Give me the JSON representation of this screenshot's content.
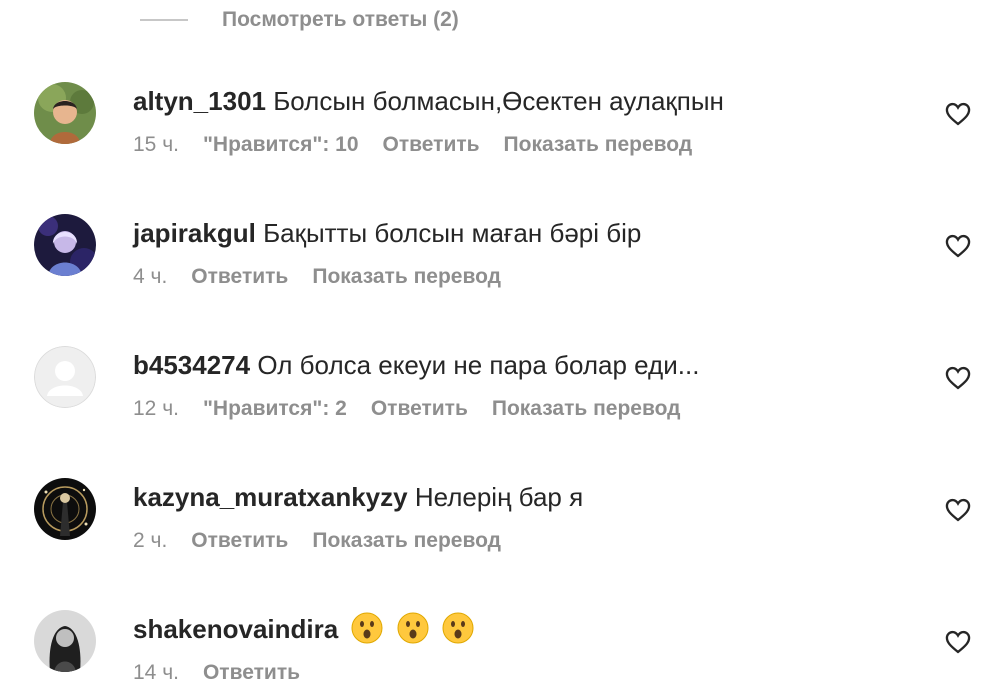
{
  "view_replies": {
    "label": "Посмотреть ответы (2)"
  },
  "comments": [
    {
      "username": "altyn_1301",
      "text": "Болсын болмасын,Өсектен аулақпын",
      "time": "15 ч.",
      "likes": "\"Нравится\": 10",
      "reply": "Ответить",
      "translate": "Показать перевод"
    },
    {
      "username": "japirakgul",
      "text": "Бақытты болсын маған бәрі бір",
      "time": "4 ч.",
      "reply": "Ответить",
      "translate": "Показать перевод"
    },
    {
      "username": "b4534274",
      "text": "Ол болса екеуи не пара болар еди...",
      "time": "12 ч.",
      "likes": "\"Нравится\": 2",
      "reply": "Ответить",
      "translate": "Показать перевод"
    },
    {
      "username": "kazyna_muratxankyzy",
      "text": "Нелерің бар я",
      "time": "2 ч.",
      "reply": "Ответить",
      "translate": "Показать перевод"
    },
    {
      "username": "shakenovaindira",
      "emojis": [
        "surprised-face-emoji",
        "surprised-face-emoji",
        "surprised-face-emoji"
      ],
      "time": "14 ч.",
      "reply": "Ответить"
    }
  ],
  "icons": {
    "like": "heart-outline-icon",
    "emoji": "surprised-face-emoji"
  },
  "colors": {
    "text_primary": "#262626",
    "text_secondary": "#8e8e8e",
    "divider": "#c7c7c7",
    "emoji_yellow": "#ffc83d"
  }
}
